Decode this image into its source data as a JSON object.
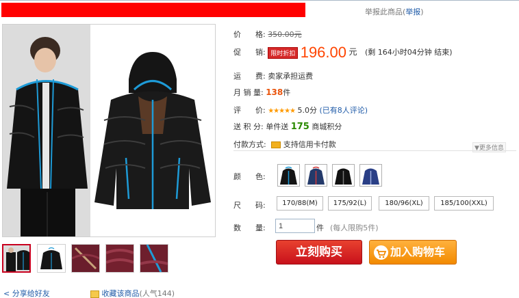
{
  "header": {
    "report_prefix": "举报此商品",
    "report_link": "举报",
    "paren_open": "(",
    "paren_close": ")"
  },
  "product": {
    "price_label": "价      格:",
    "original_price": "350.00元",
    "promo_label": "促      销:",
    "promo_badge": "限时折扣",
    "promo_price": "196.00",
    "promo_currency": "元",
    "promo_remaining": "(剩 164小时04分钟 结束)",
    "shipping_label": "运      费:",
    "shipping_value": "卖家承担运费",
    "sales_label": "月 销 量:",
    "sales_value": "138",
    "sales_unit": "件",
    "rating_label": "评      价:",
    "rating_stars": "★★★★★",
    "rating_value": "5.0分",
    "rating_reviews": "(已有8人评论)",
    "points_label": "送 积 分:",
    "points_prefix": "单件送",
    "points_value": "175",
    "points_suffix": "商城积分",
    "payment_label": "付款方式:",
    "payment_value": "支持信用卡付款",
    "more_info": "▼更多信息"
  },
  "options": {
    "color_label": "颜      色:",
    "size_label": "尺      码:",
    "sizes": [
      "170/88(M)",
      "175/92(L)",
      "180/96(XL)",
      "185/100(XXL)"
    ],
    "qty_label": "数      量:",
    "qty_value": "1",
    "qty_unit": "件",
    "qty_limit": "(每人限购5件)"
  },
  "actions": {
    "buy": "立刻购买",
    "add_cart": "加入购物车"
  },
  "footer": {
    "share": "分享给好友",
    "favorite": "收藏该商品",
    "popularity": "(人气144)"
  },
  "colors": {
    "price": "#ff4400",
    "buy_button": "#c8111b",
    "cart_button": "#f28a00",
    "link": "#1f5ba8",
    "trim_blue": "#1e9bd7"
  }
}
